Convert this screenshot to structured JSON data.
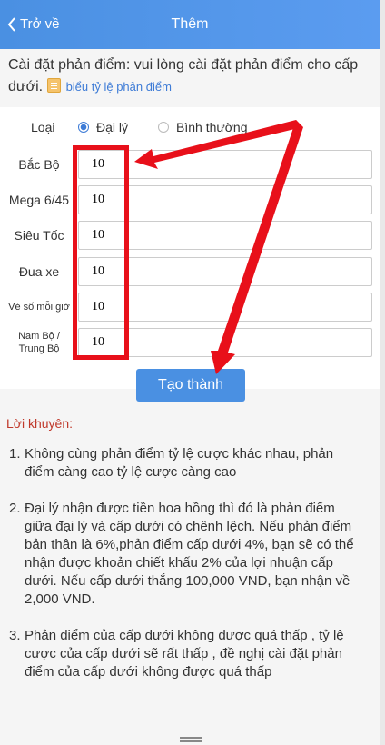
{
  "header": {
    "back_label": "Trở về",
    "title": "Thêm"
  },
  "info": {
    "text": "Cài đặt phản điểm:  vui lòng cài đặt phản điểm cho cấp dưới.",
    "link": "biểu tỷ lệ phản điểm"
  },
  "form": {
    "type_label": "Loại",
    "radios": [
      {
        "label": "Đại lý",
        "checked": true
      },
      {
        "label": "Bình thường",
        "checked": false
      }
    ],
    "rows": [
      {
        "label": "Bắc Bộ",
        "value": "10"
      },
      {
        "label": "Mega 6/45",
        "value": "10"
      },
      {
        "label": "Siêu Tốc",
        "value": "10"
      },
      {
        "label": "Đua xe",
        "value": "10"
      },
      {
        "label": "Vé số mỗi giờ",
        "value": "10"
      },
      {
        "label": "Nam Bộ / Trung Bộ",
        "value": "10"
      }
    ],
    "submit_label": "Tạo thành"
  },
  "tips": {
    "heading": "Lời khuyên:",
    "items": [
      {
        "num": "1.",
        "text": "Không cùng phản điểm tỷ lệ cược khác nhau, phản điểm càng cao tỷ lệ cược càng cao"
      },
      {
        "num": "2.",
        "text": "Đại lý nhận được tiền hoa hồng thì đó là phản điểm giữa đại lý và cấp dưới có chênh lệch. Nếu phản điểm bản thân là 6%,phản điểm cấp dưới 4%, bạn sẽ có thể nhận được khoản chiết khấu 2% của lợi nhuận cấp dưới. Nếu cấp dưới thắng 100,000 VND, bạn nhận về 2,000 VND."
      },
      {
        "num": "3.",
        "text": "Phản điểm của cấp dưới không được quá thấp , tỷ lệ cược của cấp dưới sẽ rất thấp , đề nghị cài đặt phản điểm của cấp dưới không được quá thấp"
      }
    ]
  },
  "colors": {
    "header": "#4a90e2",
    "annotation": "#e8101a",
    "link": "#3d7bd6"
  }
}
